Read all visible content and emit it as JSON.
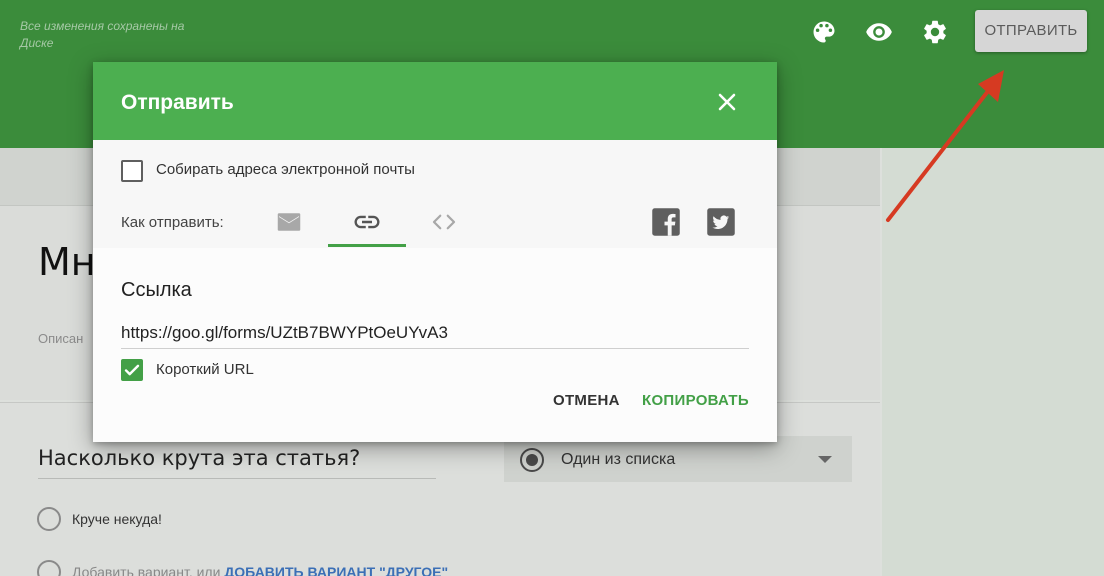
{
  "app": {
    "save_status": "Все изменения сохранены на Диске",
    "send_button": "ОТПРАВИТЬ",
    "icons": [
      "palette-icon",
      "eye-icon",
      "gear-icon"
    ]
  },
  "form": {
    "title": "Мн",
    "description": "Описан"
  },
  "question": {
    "title": "Насколько крута эта статья?",
    "type": "Один из списка",
    "options": [
      "Круче некуда!"
    ],
    "add_option_text": "Добавить вариант",
    "add_option_or": "или",
    "add_other_link": "ДОБАВИТЬ ВАРИАНТ \"ДРУГОЕ\""
  },
  "dialog": {
    "title": "Отправить",
    "collect_emails_label": "Собирать адреса электронной почты",
    "collect_emails_checked": false,
    "send_method_label": "Как отправить:",
    "send_methods": [
      "email-icon",
      "link-icon",
      "embed-icon"
    ],
    "active_method": "link-icon",
    "share_icons": [
      "facebook-icon",
      "twitter-icon"
    ],
    "link_heading": "Ссылка",
    "link_value": "https://goo.gl/forms/UZtB7BWYPtOeUYvA3",
    "short_url_label": "Короткий URL",
    "short_url_checked": true,
    "cancel_button": "ОТМЕНА",
    "copy_button": "КОПИРОВАТЬ"
  },
  "colors": {
    "topbar": "#3b8c3b",
    "dialog_header": "#4caf50",
    "accent": "#43a047",
    "arrow": "#d63a22"
  }
}
